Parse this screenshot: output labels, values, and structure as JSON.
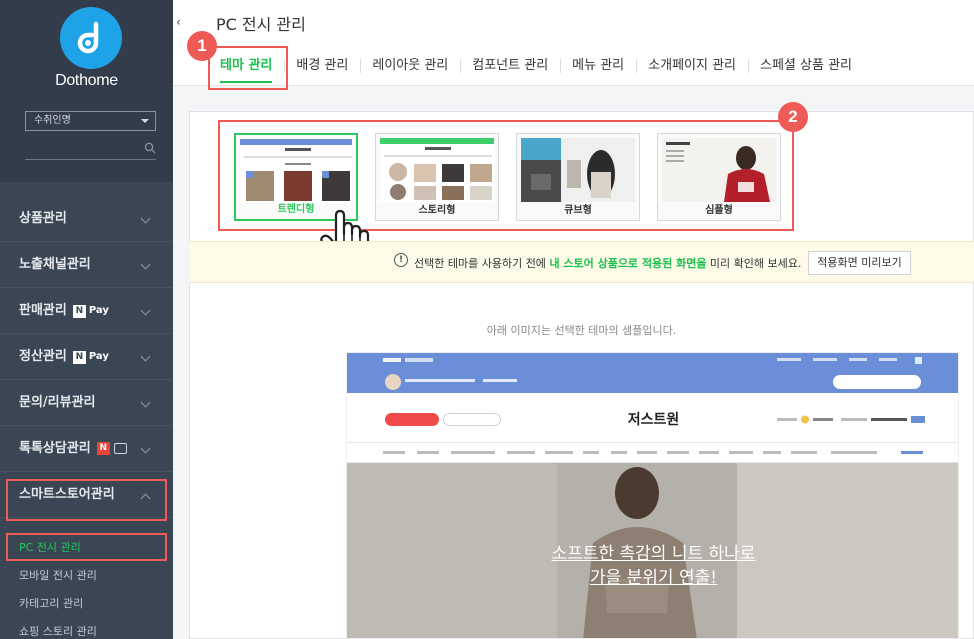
{
  "sidebar": {
    "brand": "Dothome",
    "store_select": "수취인명",
    "menu": [
      {
        "label": "상품관리"
      },
      {
        "label": "노출채널관리"
      },
      {
        "label": "판매관리"
      },
      {
        "label": "정산관리"
      },
      {
        "label": "문의/리뷰관리"
      },
      {
        "label": "톡톡상담관리"
      },
      {
        "label": "스마트스토어관리"
      }
    ],
    "npay_label": "Pay",
    "npay_n": "N",
    "new_badge": "N",
    "submenu": [
      {
        "label": "PC 전시 관리"
      },
      {
        "label": "모바일 전시 관리"
      },
      {
        "label": "카테고리 관리"
      },
      {
        "label": "쇼핑 스토리 관리"
      }
    ]
  },
  "header": {
    "collapse_glyph": "‹",
    "title": "PC 전시 관리",
    "tabs": [
      {
        "label": "테마 관리"
      },
      {
        "label": "배경 관리"
      },
      {
        "label": "레이아웃 관리"
      },
      {
        "label": "컴포넌트 관리"
      },
      {
        "label": "메뉴 관리"
      },
      {
        "label": "소개페이지 관리"
      },
      {
        "label": "스페셜 상품 관리"
      }
    ]
  },
  "badges": {
    "one": "1",
    "two": "2"
  },
  "themes": [
    {
      "label": "트렌디형"
    },
    {
      "label": "스토리형"
    },
    {
      "label": "큐브형"
    },
    {
      "label": "심플형"
    }
  ],
  "notice": {
    "part1": "선택한 테마를 사용하기 전에 ",
    "highlight": "내 스토어 상품으로 적용된 화면을",
    "part2": " 미리 확인해 보세요.",
    "button": "적용화면 미리보기"
  },
  "sample": {
    "caption": "아래 이미지는 선택한 테마의 샘플입니다.",
    "store_title": "저스트원",
    "hero_line1": "소프트한 촉감의 니트 하나로",
    "hero_line2": "가을 분위기 연출!"
  },
  "colors": {
    "accent": "#1bbf4f",
    "highlight_box": "#ee5a55",
    "sidebar_bg": "#3b4655",
    "logo": "#1fa3e8"
  }
}
